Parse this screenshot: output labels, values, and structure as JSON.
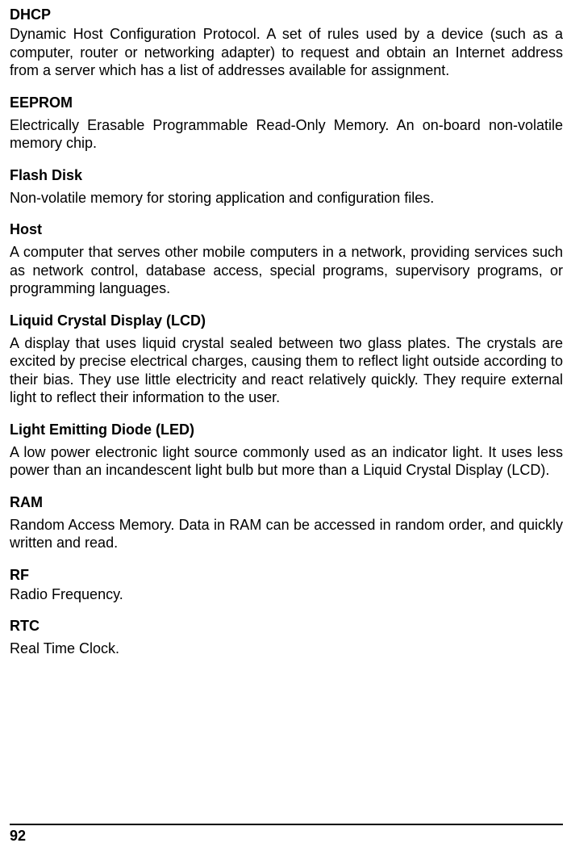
{
  "entries": [
    {
      "term": "DHCP",
      "definition": "Dynamic Host Configuration Protocol. A set of rules used by a device (such as a computer, router or networking adapter) to request and obtain an Internet address from a server which has a list of addresses available for assignment.",
      "tight": true
    },
    {
      "term": "EEPROM",
      "definition": "Electrically Erasable Programmable Read-Only Memory. An on-board non-volatile memory chip."
    },
    {
      "term": "Flash Disk",
      "definition": "Non-volatile memory for storing application and configuration files."
    },
    {
      "term": "Host",
      "definition": "A computer that serves other mobile computers in a network, providing services such as network control, database access, special programs, supervisory programs, or programming languages."
    },
    {
      "term": "Liquid Crystal Display (LCD)",
      "definition": "A display that uses liquid crystal sealed between two glass plates. The crystals are excited by precise electrical charges, causing them to reflect light outside according to their bias. They use little electricity and react relatively quickly. They require external light to reflect their information to the user."
    },
    {
      "term": "Light Emitting Diode (LED)",
      "definition": "A low power electronic light source commonly used as an indicator light. It uses less power than an incandescent light bulb but more than a Liquid Crystal Display (LCD)."
    },
    {
      "term": "RAM",
      "definition": "Random Access Memory. Data in RAM can be accessed in random order, and quickly written and read."
    },
    {
      "term": "RF",
      "definition": "Radio Frequency.",
      "tight": true
    },
    {
      "term": "RTC",
      "definition": "Real Time Clock."
    }
  ],
  "page_number": "92"
}
